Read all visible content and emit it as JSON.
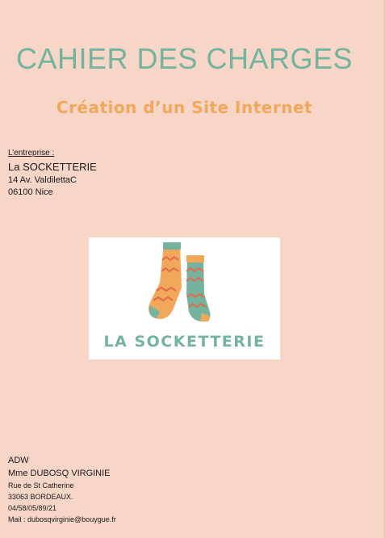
{
  "document": {
    "title": "CAHIER DES CHARGES",
    "subtitle": "Création d’un Site Internet"
  },
  "company": {
    "label": "L’entreprise :",
    "name": "La SOCKETTERIE",
    "address": "14 Av. ValdilettaC",
    "city": "06100 Nice"
  },
  "logo": {
    "text": "LA SOCKETTERIE",
    "colors": {
      "orange": "#f2a85a",
      "teal": "#74b39e",
      "accent": "#e56a4b"
    }
  },
  "author": {
    "org": "ADW",
    "name": "Mme DUBOSQ VIRGINIE",
    "street": "Rue de St Catherine",
    "city": "33063 BORDEAUX.",
    "phone": "04/58/05/89/21",
    "mail": "Mail : dubosqvirginie@bouygue.fr"
  },
  "colors": {
    "background": "#f7d5c7",
    "title": "#74b39e",
    "subtitle": "#f2a85a"
  }
}
